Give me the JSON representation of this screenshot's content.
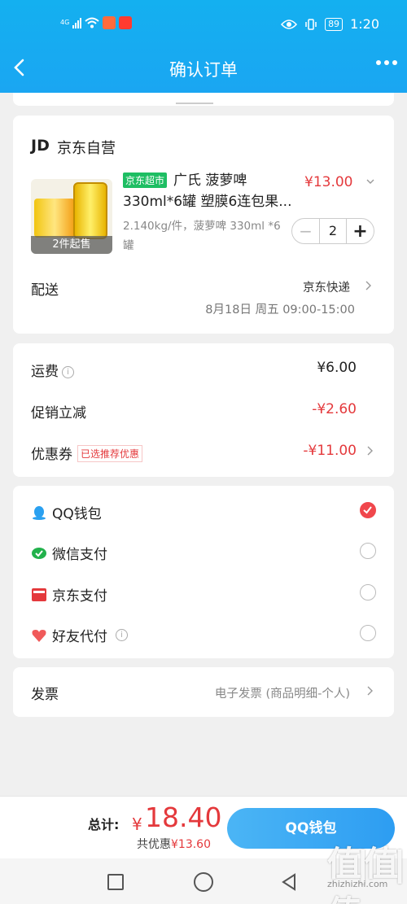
{
  "status": {
    "network": "4G",
    "battery": "89",
    "time": "1:20"
  },
  "nav": {
    "title": "确认订单"
  },
  "shop": {
    "logo": "JD",
    "name": "京东自营"
  },
  "product": {
    "badge": "京东超市",
    "name": "广氏 菠萝啤 330ml*6罐 塑膜6连包果...",
    "spec": "2.140kg/件，菠萝啤 330ml *6罐",
    "image_tag": "2件起售",
    "price": "¥13.00",
    "quantity": "2"
  },
  "shipping": {
    "label": "配送",
    "method": "京东快递",
    "time": "8月18日 周五 09:00-15:00"
  },
  "fees": {
    "freight_label": "运费",
    "freight_value": "¥6.00",
    "promo_label": "促销立减",
    "promo_value": "-¥2.60",
    "coupon_label": "优惠券",
    "coupon_tag": "已选推荐优惠",
    "coupon_value": "-¥11.00"
  },
  "payment": {
    "options": [
      {
        "label": "QQ钱包",
        "icon": "qq-icon",
        "selected": true
      },
      {
        "label": "微信支付",
        "icon": "wechat-icon",
        "selected": false
      },
      {
        "label": "京东支付",
        "icon": "jdpay-icon",
        "selected": false
      },
      {
        "label": "好友代付",
        "icon": "friend-pay-icon",
        "selected": false
      }
    ]
  },
  "invoice": {
    "label": "发票",
    "value": "电子发票 (商品明细-个人)"
  },
  "footer": {
    "total_label": "总计:",
    "currency": "¥",
    "total": "18.40",
    "saved_prefix": "共优惠",
    "saved": "¥13.60",
    "pay_button": "QQ钱包"
  },
  "watermark": {
    "main": "值|值|值",
    "sub": "zhizhizhi.com"
  },
  "colors": {
    "header": "#18acf0",
    "price_red": "#e4393c",
    "badge_green": "#1ebe63",
    "pay_button": "#3aa8f4"
  }
}
